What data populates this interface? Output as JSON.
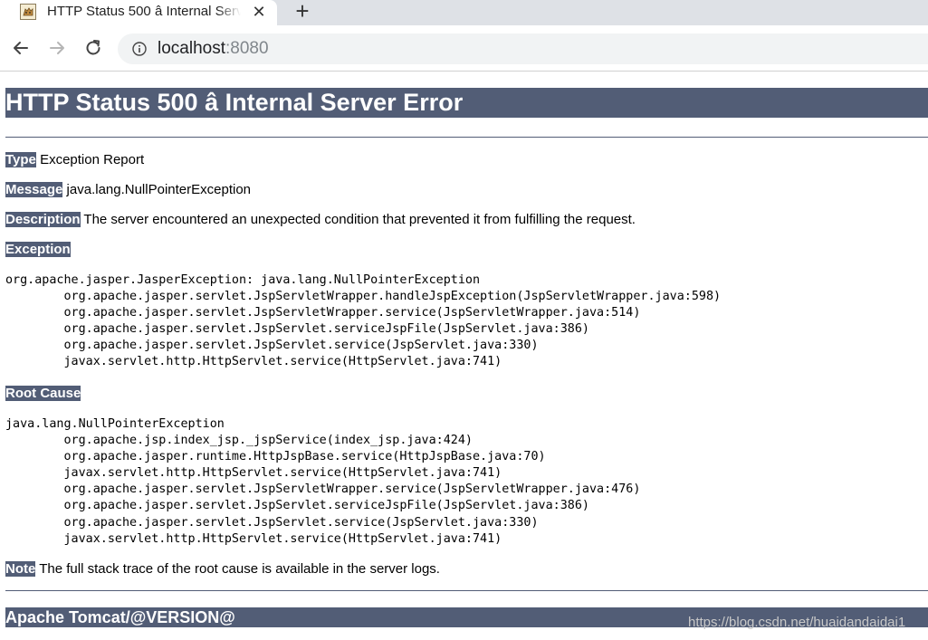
{
  "browser": {
    "tab_title": "HTTP Status 500 â Internal Server Error",
    "tab_close": "✕",
    "new_tab": "+",
    "url_host": "localhost",
    "url_port": ":8080"
  },
  "page": {
    "title": "HTTP Status 500 â Internal Server Error",
    "type_label": "Type",
    "type_value": "Exception Report",
    "message_label": "Message",
    "message_value": "java.lang.NullPointerException",
    "description_label": "Description",
    "description_value": "The server encountered an unexpected condition that prevented it from fulfilling the request.",
    "exception_label": "Exception",
    "exception_trace": "org.apache.jasper.JasperException: java.lang.NullPointerException\n\torg.apache.jasper.servlet.JspServletWrapper.handleJspException(JspServletWrapper.java:598)\n\torg.apache.jasper.servlet.JspServletWrapper.service(JspServletWrapper.java:514)\n\torg.apache.jasper.servlet.JspServlet.serviceJspFile(JspServlet.java:386)\n\torg.apache.jasper.servlet.JspServlet.service(JspServlet.java:330)\n\tjavax.servlet.http.HttpServlet.service(HttpServlet.java:741)",
    "root_cause_label": "Root Cause",
    "root_cause_trace": "java.lang.NullPointerException\n\torg.apache.jsp.index_jsp._jspService(index_jsp.java:424)\n\torg.apache.jasper.runtime.HttpJspBase.service(HttpJspBase.java:70)\n\tjavax.servlet.http.HttpServlet.service(HttpServlet.java:741)\n\torg.apache.jasper.servlet.JspServletWrapper.service(JspServletWrapper.java:476)\n\torg.apache.jasper.servlet.JspServlet.serviceJspFile(JspServlet.java:386)\n\torg.apache.jasper.servlet.JspServlet.service(JspServlet.java:330)\n\tjavax.servlet.http.HttpServlet.service(HttpServlet.java:741)",
    "note_label": "Note",
    "note_value": "The full stack trace of the root cause is available in the server logs.",
    "footer": "Apache Tomcat/@VERSION@"
  },
  "watermark": "https://blog.csdn.net/huaidandaidai1",
  "icons": {
    "favicon": "tomcat-icon",
    "back": "back-arrow-icon",
    "forward": "forward-arrow-icon",
    "reload": "reload-icon",
    "info": "info-icon"
  },
  "colors": {
    "label_bg": "#525d76",
    "label_fg": "#ffffff",
    "tab_strip": "#dee1e6",
    "address_bar": "#f1f3f4"
  }
}
